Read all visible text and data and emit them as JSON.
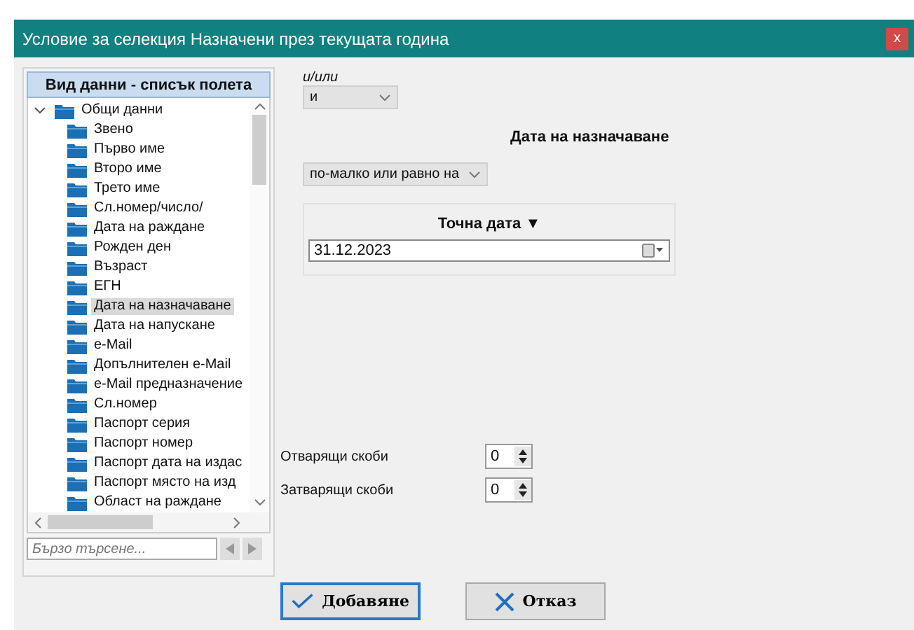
{
  "window": {
    "title": "Условие за селекция Назначени през текущата година",
    "close": "x"
  },
  "field_panel": {
    "header": "Вид данни - списък полета",
    "tree": [
      {
        "label": "Общи данни",
        "expanded": true,
        "selected": false,
        "children": [
          {
            "label": "Звено",
            "selected": false
          },
          {
            "label": "Първо име",
            "selected": false
          },
          {
            "label": "Второ име",
            "selected": false
          },
          {
            "label": "Трето име",
            "selected": false
          },
          {
            "label": "Сл.номер/число/",
            "selected": false
          },
          {
            "label": "Дата на раждане",
            "selected": false
          },
          {
            "label": "Рожден ден",
            "selected": false
          },
          {
            "label": "Възраст",
            "selected": false
          },
          {
            "label": "ЕГН",
            "selected": false
          },
          {
            "label": "Дата на назначаване",
            "selected": true
          },
          {
            "label": "Дата на напускане",
            "selected": false
          },
          {
            "label": "e-Mail",
            "selected": false
          },
          {
            "label": "Допълнителен e-Mail",
            "selected": false
          },
          {
            "label": "e-Mail предназначение",
            "selected": false
          },
          {
            "label": "Сл.номер",
            "selected": false
          },
          {
            "label": "Паспорт серия",
            "selected": false
          },
          {
            "label": "Паспорт номер",
            "selected": false
          },
          {
            "label": "Паспорт дата на издас",
            "selected": false
          },
          {
            "label": "Паспорт място на изд",
            "selected": false
          },
          {
            "label": "Област на раждане",
            "selected": false
          }
        ]
      }
    ],
    "search": {
      "placeholder": "Бързо търсене..."
    }
  },
  "condition": {
    "logic_label": "и/или",
    "logic_value": "и",
    "field_title": "Дата на назначаване",
    "operator": "по-малко или равно на",
    "value_mode": "Точна дата ▼",
    "date": "31.12.2023"
  },
  "brackets": [
    {
      "label": "Отварящи скоби",
      "value": "0"
    },
    {
      "label": "Затварящи скоби",
      "value": "0"
    }
  ],
  "buttons": [
    {
      "kind": "add",
      "label": "Добавяне"
    },
    {
      "kind": "cancel",
      "label": "Отказ"
    }
  ]
}
